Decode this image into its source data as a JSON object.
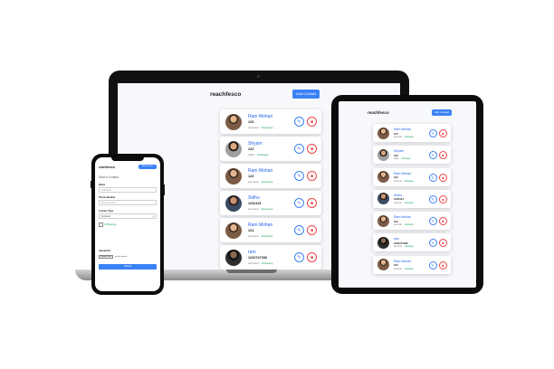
{
  "app": {
    "brand": "reachfesco",
    "add_contact_label": "Add Contact"
  },
  "laptop": {
    "contacts": [
      {
        "name": "Ram Mohan",
        "phone": "123",
        "tags": [
          "personal",
          "whatsapp"
        ],
        "avatar": ""
      },
      {
        "name": "Shyam",
        "phone": "123",
        "tags": [
          "office",
          "whatsapp"
        ],
        "avatar": "alt"
      },
      {
        "name": "Ram Mohan",
        "phone": "123",
        "tags": [
          "personal",
          "whatsapp"
        ],
        "avatar": ""
      },
      {
        "name": "Sidhu",
        "phone": "1232131",
        "tags": [
          "personal",
          "whatsapp"
        ],
        "avatar": "alt2"
      },
      {
        "name": "Ram Mohan",
        "phone": "123",
        "tags": [
          "personal",
          "whatsapp"
        ],
        "avatar": ""
      },
      {
        "name": "ram",
        "phone": "1232747336",
        "tags": [
          "personal",
          "whatsapp"
        ],
        "avatar": "dark"
      }
    ]
  },
  "tablet": {
    "contacts": [
      {
        "name": "Ram Mohan",
        "phone": "123",
        "tags": [
          "personal",
          "whatsapp"
        ],
        "avatar": ""
      },
      {
        "name": "Shyam",
        "phone": "123",
        "tags": [
          "office",
          "whatsapp"
        ],
        "avatar": "alt"
      },
      {
        "name": "Ram Mohan",
        "phone": "123",
        "tags": [
          "personal",
          "whatsapp"
        ],
        "avatar": ""
      },
      {
        "name": "Sidhu",
        "phone": "1232131",
        "tags": [
          "personal",
          "whatsapp"
        ],
        "avatar": "alt2"
      },
      {
        "name": "Ram Mohan",
        "phone": "123",
        "tags": [
          "personal",
          "whatsapp"
        ],
        "avatar": ""
      },
      {
        "name": "ram",
        "phone": "1232747336",
        "tags": [
          "personal",
          "whatsapp"
        ],
        "avatar": "dark"
      },
      {
        "name": "Ram Mohan",
        "phone": "123",
        "tags": [
          "personal",
          "whatsapp"
        ],
        "avatar": ""
      }
    ]
  },
  "phone": {
    "form_title": "Save a Contact",
    "name_label": "Name",
    "name_placeholder": "Full Name",
    "phone_label": "Phone Number",
    "phone_placeholder": "Phone Number",
    "type_label": "Contact Type",
    "type_value": "Personal",
    "whatsapp_label": "Is WhatsApp",
    "photo_label": "Upload Pic",
    "upload_button": "Choose File",
    "upload_filename": "no file chosen",
    "submit_label": "Submit"
  },
  "icons": {
    "edit": "pencil-icon",
    "delete": "trash-icon"
  },
  "colors": {
    "accent": "#3b82f6",
    "name_link": "#2563eb",
    "delete": "#ef4444",
    "whatsapp": "#22a55a"
  }
}
